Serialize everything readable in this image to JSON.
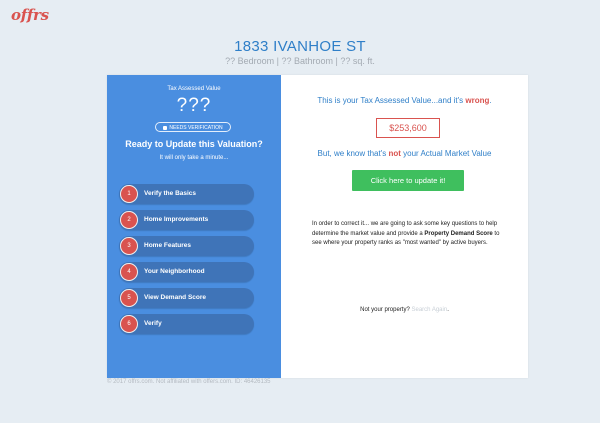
{
  "brand": {
    "logo_text": "offrs"
  },
  "property": {
    "address": "1833 IVANHOE ST",
    "specs": "?? Bedroom | ?? Bathroom | ?? sq. ft."
  },
  "valuation_panel": {
    "label": "Tax Assessed Value",
    "value": "???",
    "badge": "NEEDS VERIFICATION",
    "heading": "Ready to Update this Valuation?",
    "subheading": "It will only take a minute...",
    "steps": [
      {
        "num": "1",
        "label": "Verify the Basics"
      },
      {
        "num": "2",
        "label": "Home Improvements"
      },
      {
        "num": "3",
        "label": "Home Features"
      },
      {
        "num": "4",
        "label": "Your Neighborhood"
      },
      {
        "num": "5",
        "label": "View Demand Score"
      },
      {
        "num": "6",
        "label": "Verify"
      }
    ]
  },
  "main": {
    "headline_prefix": "This is your Tax Assessed Value...and it's ",
    "headline_emphasis": "wrong",
    "headline_suffix": ".",
    "assessed_value": "$253,600",
    "market_prefix": "But, we know that's ",
    "market_emphasis": "not",
    "market_suffix": " your Actual Market Value",
    "update_button": "Click here to update it!",
    "desc_prefix": "In order to correct it... we are going to ask some key questions to help determine the market value and provide a ",
    "desc_bold": "Property Demand Score",
    "desc_suffix": " to see where your property ranks as \"most wanted\" by active buyers.",
    "not_property": "Not your property?",
    "search_again": "Search Again",
    "period": "."
  },
  "footer": {
    "text": "© 2017 offrs.com. Not affiliated with offers.com. ID: 46426135"
  },
  "colors": {
    "background": "#e6edf3",
    "panel_blue": "#4a8ee0",
    "step_blue": "#3f74b8",
    "accent_red": "#d9534f",
    "button_green": "#3fbf5e",
    "text_blue": "#2f7fc8"
  }
}
